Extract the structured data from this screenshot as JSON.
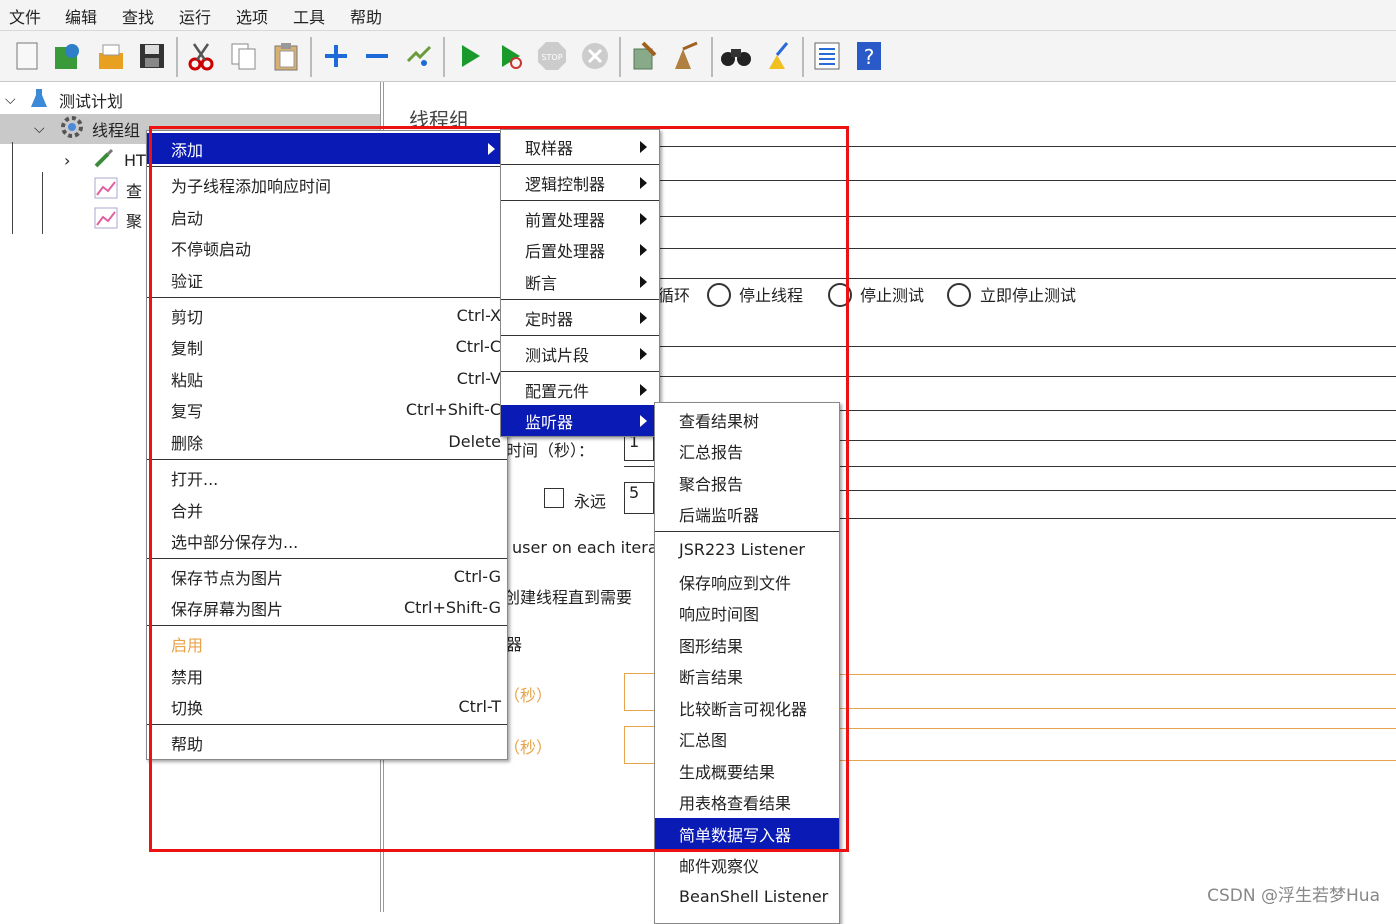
{
  "menubar": [
    "文件",
    "编辑",
    "查找",
    "运行",
    "选项",
    "工具",
    "帮助"
  ],
  "toolbar_icons": [
    "new-icon",
    "templates-icon",
    "open-icon",
    "save-icon",
    "cut-icon",
    "copy-icon",
    "paste-icon",
    "add-icon",
    "remove-icon",
    "toggle-icon",
    "start-icon",
    "start-no-pause-icon",
    "stop-icon",
    "shutdown-icon",
    "clear-icon",
    "clear-all-icon",
    "search-icon",
    "reset-search-icon",
    "function-helper-icon",
    "help-icon"
  ],
  "tree": {
    "test_plan": "测试计划",
    "thread_group": "线程组",
    "http_request": "HT",
    "view_results": "查",
    "aggregate": "聚"
  },
  "panel": {
    "title": "线程组",
    "loop_suffix": "循环",
    "radio_stop_thread": "停止线程",
    "radio_stop_test": "停止测试",
    "radio_stop_now": "立即停止测试",
    "ramp_label": "时间（秒）：",
    "ramp_value": "1",
    "forever_label": "永远",
    "loop_value": "5",
    "same_user": "user on each iterat",
    "delay_create": "创建线程直到需要",
    "scheduler": "器",
    "duration_label": "（秒）",
    "delay_label": "（秒）"
  },
  "context_menu": {
    "add": "添加",
    "add_think_time": "为子线程添加响应时间",
    "start": "启动",
    "start_no_pause": "不停顿启动",
    "validate": "验证",
    "cut": "剪切",
    "cut_acc": "Ctrl-X",
    "copy": "复制",
    "copy_acc": "Ctrl-C",
    "paste": "粘贴",
    "paste_acc": "Ctrl-V",
    "duplicate": "复写",
    "duplicate_acc": "Ctrl+Shift-C",
    "delete": "删除",
    "delete_acc": "Delete",
    "open": "打开...",
    "merge": "合并",
    "save_selection": "选中部分保存为...",
    "save_node_image": "保存节点为图片",
    "save_node_image_acc": "Ctrl-G",
    "save_screen_image": "保存屏幕为图片",
    "save_screen_image_acc": "Ctrl+Shift-G",
    "enable": "启用",
    "disable": "禁用",
    "toggle": "切换",
    "toggle_acc": "Ctrl-T",
    "help": "帮助"
  },
  "add_submenu": {
    "sampler": "取样器",
    "logic_controller": "逻辑控制器",
    "pre_processor": "前置处理器",
    "post_processor": "后置处理器",
    "assertion": "断言",
    "timer": "定时器",
    "test_fragment": "测试片段",
    "config_element": "配置元件",
    "listener": "监听器"
  },
  "listener_submenu": [
    "查看结果树",
    "汇总报告",
    "聚合报告",
    "后端监听器",
    "JSR223 Listener",
    "保存响应到文件",
    "响应时间图",
    "图形结果",
    "断言结果",
    "比较断言可视化器",
    "汇总图",
    "生成概要结果",
    "用表格查看结果",
    "简单数据写入器",
    "邮件观察仪",
    "BeanShell Listener"
  ],
  "listener_selected": "简单数据写入器",
  "watermark": "CSDN @浮生若梦Hua",
  "colors": {
    "highlight": "#0a1ab4",
    "disabled": "#e8a44a",
    "annotation": "#e11111"
  }
}
